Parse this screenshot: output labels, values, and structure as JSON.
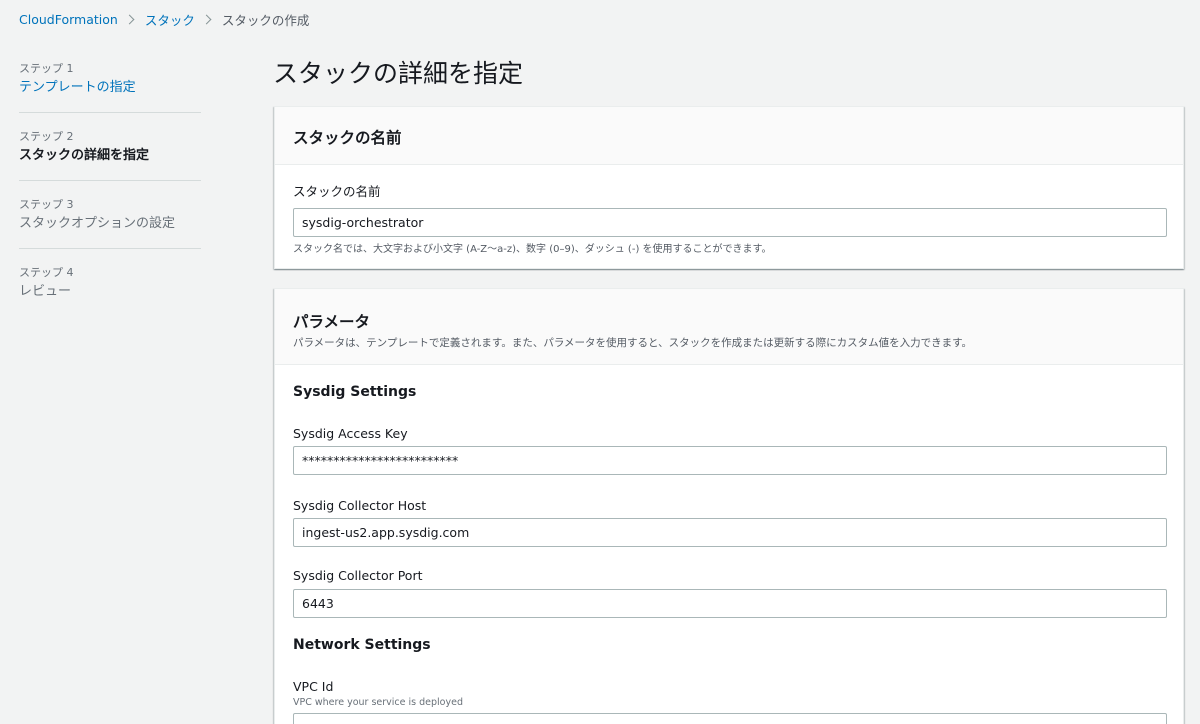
{
  "breadcrumb": {
    "items": [
      "CloudFormation",
      "スタック",
      "スタックの作成"
    ]
  },
  "steps": [
    {
      "num": "ステップ 1",
      "label": "テンプレートの指定",
      "state": "link"
    },
    {
      "num": "ステップ 2",
      "label": "スタックの詳細を指定",
      "state": "active"
    },
    {
      "num": "ステップ 3",
      "label": "スタックオプションの設定",
      "state": "disabled"
    },
    {
      "num": "ステップ 4",
      "label": "レビュー",
      "state": "disabled"
    }
  ],
  "page": {
    "title": "スタックの詳細を指定"
  },
  "stack_name_panel": {
    "title": "スタックの名前",
    "field_label": "スタックの名前",
    "value": "sysdig-orchestrator",
    "help": "スタック名では、大文字および小文字 (A-Z〜a-z)、数字 (0–9)、ダッシュ (-) を使用することができます。"
  },
  "params_panel": {
    "title": "パラメータ",
    "description": "パラメータは、テンプレートで定義されます。また、パラメータを使用すると、スタックを作成または更新する際にカスタム値を入力できます。",
    "sysdig_section": "Sysdig Settings",
    "access_key_label": "Sysdig Access Key",
    "access_key_value": "*************************",
    "collector_host_label": "Sysdig Collector Host",
    "collector_host_value": "ingest-us2.app.sysdig.com",
    "collector_port_label": "Sysdig Collector Port",
    "collector_port_value": "6443",
    "network_section": "Network Settings",
    "vpc_label": "VPC Id",
    "vpc_sublabel": "VPC where your service is deployed"
  },
  "colors": {
    "link": "#0073bb",
    "background": "#f2f3f3",
    "text": "#16191f"
  }
}
